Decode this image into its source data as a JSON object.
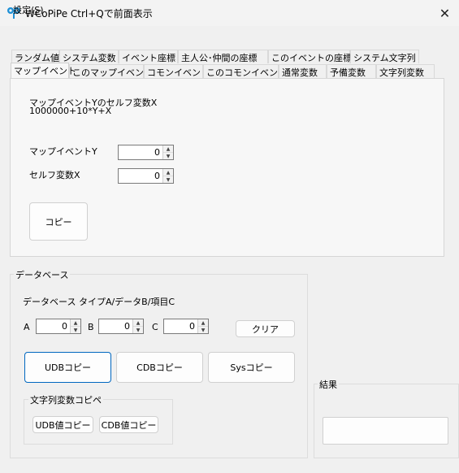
{
  "window": {
    "title": "WCoPiPe  Ctrl+Qで前面表示",
    "close_glyph": "✕"
  },
  "menu": {
    "settings_label": "設定(",
    "settings_mnemonic": "S",
    "settings_suffix": ")"
  },
  "tabs_row1": [
    "ランダム値",
    "システム変数",
    "イベント座標",
    "主人公･仲間の座標",
    "このイベントの座標",
    "システム文字列"
  ],
  "tabs_row2": [
    "マップイベント",
    "このマップイベント",
    "コモンイベント",
    "このコモンイベント",
    "通常変数",
    "予備変数",
    "文字列変数"
  ],
  "active_tab": "マップイベント",
  "map_event": {
    "formula_title": "マップイベントYのセルフ変数X",
    "formula": "1000000+10*Y+X",
    "event_y_label": "マップイベントY",
    "event_y_value": "0",
    "self_var_label": "セルフ変数X",
    "self_var_value": "0",
    "copy_button": "コピー"
  },
  "database": {
    "group_title": "データベース",
    "description": "データベース  タイプA/データB/項目C",
    "a_label": "A",
    "a_value": "0",
    "b_label": "B",
    "b_value": "0",
    "c_label": "C",
    "c_value": "0",
    "clear_button": "クリア",
    "udb_copy": "UDBコピー",
    "cdb_copy": "CDBコピー",
    "sys_copy": "Sysコピー",
    "string_group_title": "文字列変数コピペ",
    "udb_value_copy": "UDB値コピー",
    "cdb_value_copy": "CDB値コピー"
  },
  "result": {
    "group_title": "結果",
    "value": ""
  }
}
